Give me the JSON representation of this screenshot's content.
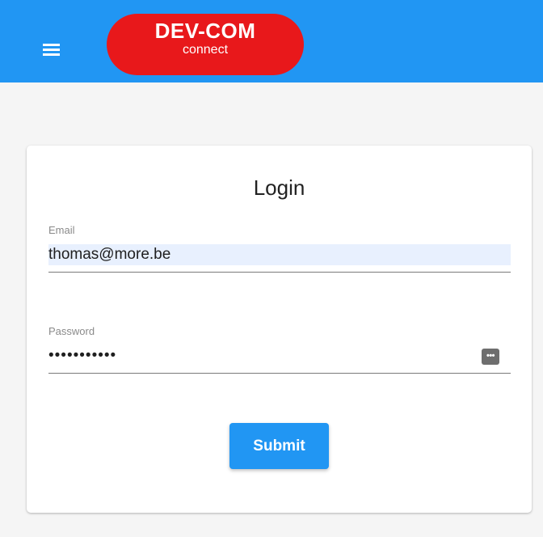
{
  "header": {
    "menu_icon": "hamburger-menu-icon",
    "logo": {
      "main_text": "DEV-COM",
      "sub_text": "connect"
    }
  },
  "login_form": {
    "title": "Login",
    "email": {
      "label": "Email",
      "value": "thomas@more.be"
    },
    "password": {
      "label": "Password",
      "value": "•••••••••••",
      "toggle_icon": "password-dots-icon",
      "toggle_text": "•••"
    },
    "submit_label": "Submit"
  },
  "colors": {
    "app_bar": "#2196f3",
    "logo_background": "#e8181b",
    "page_background": "#f5f5f5",
    "button": "#2196f3",
    "autofill": "#e8f0fe"
  }
}
